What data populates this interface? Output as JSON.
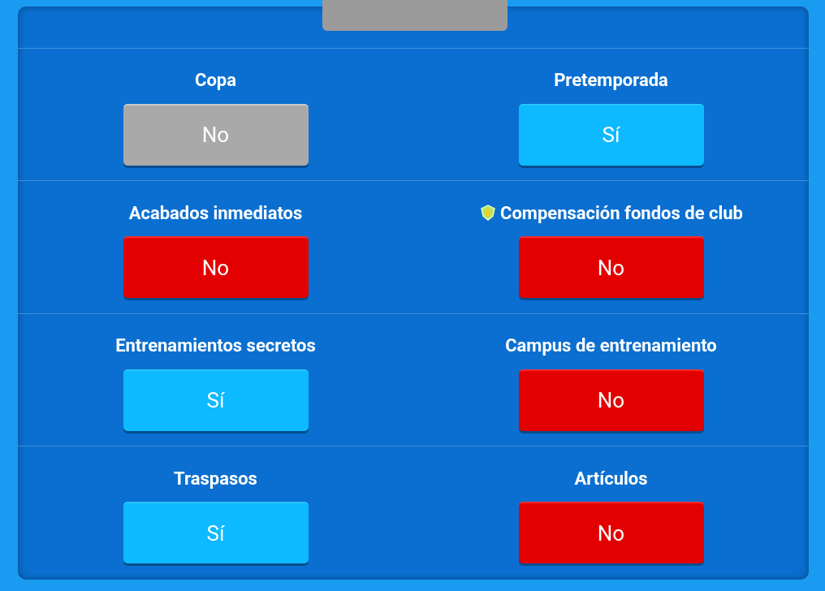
{
  "settings": [
    {
      "label": "Copa",
      "value": "No",
      "kind": "disabled",
      "badge": false
    },
    {
      "label": "Pretemporada",
      "value": "Sí",
      "kind": "on",
      "badge": false
    },
    {
      "label": "Acabados inmediatos",
      "value": "No",
      "kind": "off",
      "badge": false
    },
    {
      "label": "Compensación fondos de club",
      "value": "No",
      "kind": "off",
      "badge": true
    },
    {
      "label": "Entrenamientos secretos",
      "value": "Sí",
      "kind": "on",
      "badge": false
    },
    {
      "label": "Campus de entrenamiento",
      "value": "No",
      "kind": "off",
      "badge": false
    },
    {
      "label": "Traspasos",
      "value": "Sí",
      "kind": "on",
      "badge": false
    },
    {
      "label": "Artículos",
      "value": "No",
      "kind": "off",
      "badge": false
    }
  ]
}
